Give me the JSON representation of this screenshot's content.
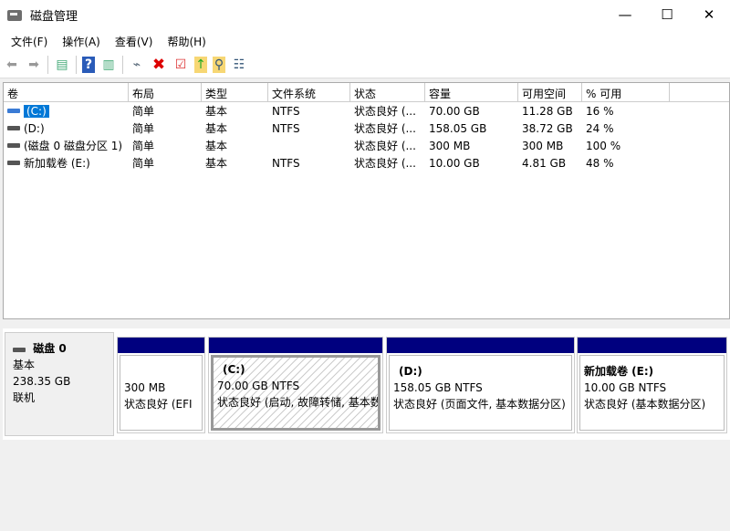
{
  "window": {
    "title": "磁盘管理",
    "minimize": "—",
    "maximize": "☐",
    "close": "✕"
  },
  "menu": [
    "文件(F)",
    "操作(A)",
    "查看(V)",
    "帮助(H)"
  ],
  "columns": [
    "卷",
    "布局",
    "类型",
    "文件系统",
    "状态",
    "容量",
    "可用空间",
    "% 可用"
  ],
  "volumes": [
    {
      "name": "(C:)",
      "layout": "简单",
      "type": "基本",
      "fs": "NTFS",
      "status": "状态良好 (...",
      "capacity": "70.00 GB",
      "free": "11.28 GB",
      "pct": "16 %"
    },
    {
      "name": "(D:)",
      "layout": "简单",
      "type": "基本",
      "fs": "NTFS",
      "status": "状态良好 (...",
      "capacity": "158.05 GB",
      "free": "38.72 GB",
      "pct": "24 %"
    },
    {
      "name": "(磁盘 0 磁盘分区 1)",
      "layout": "简单",
      "type": "基本",
      "fs": "",
      "status": "状态良好 (...",
      "capacity": "300 MB",
      "free": "300 MB",
      "pct": "100 %"
    },
    {
      "name": "新加载卷 (E:)",
      "layout": "简单",
      "type": "基本",
      "fs": "NTFS",
      "status": "状态良好 (...",
      "capacity": "10.00 GB",
      "free": "4.81 GB",
      "pct": "48 %"
    }
  ],
  "disk": {
    "name": "磁盘 0",
    "type": "基本",
    "size": "238.35 GB",
    "state": "联机"
  },
  "partitions": [
    {
      "label": "",
      "size": "300 MB",
      "status": "状态良好 (EFI"
    },
    {
      "label": "(C:)",
      "size": "70.00 GB NTFS",
      "status": "状态良好 (启动, 故障转储, 基本数据分区)"
    },
    {
      "label": "(D:)",
      "size": "158.05 GB NTFS",
      "status": "状态良好 (页面文件, 基本数据分区)"
    },
    {
      "label": "新加载卷  (E:)",
      "size": "10.00 GB NTFS",
      "status": "状态良好 (基本数据分区)"
    }
  ]
}
